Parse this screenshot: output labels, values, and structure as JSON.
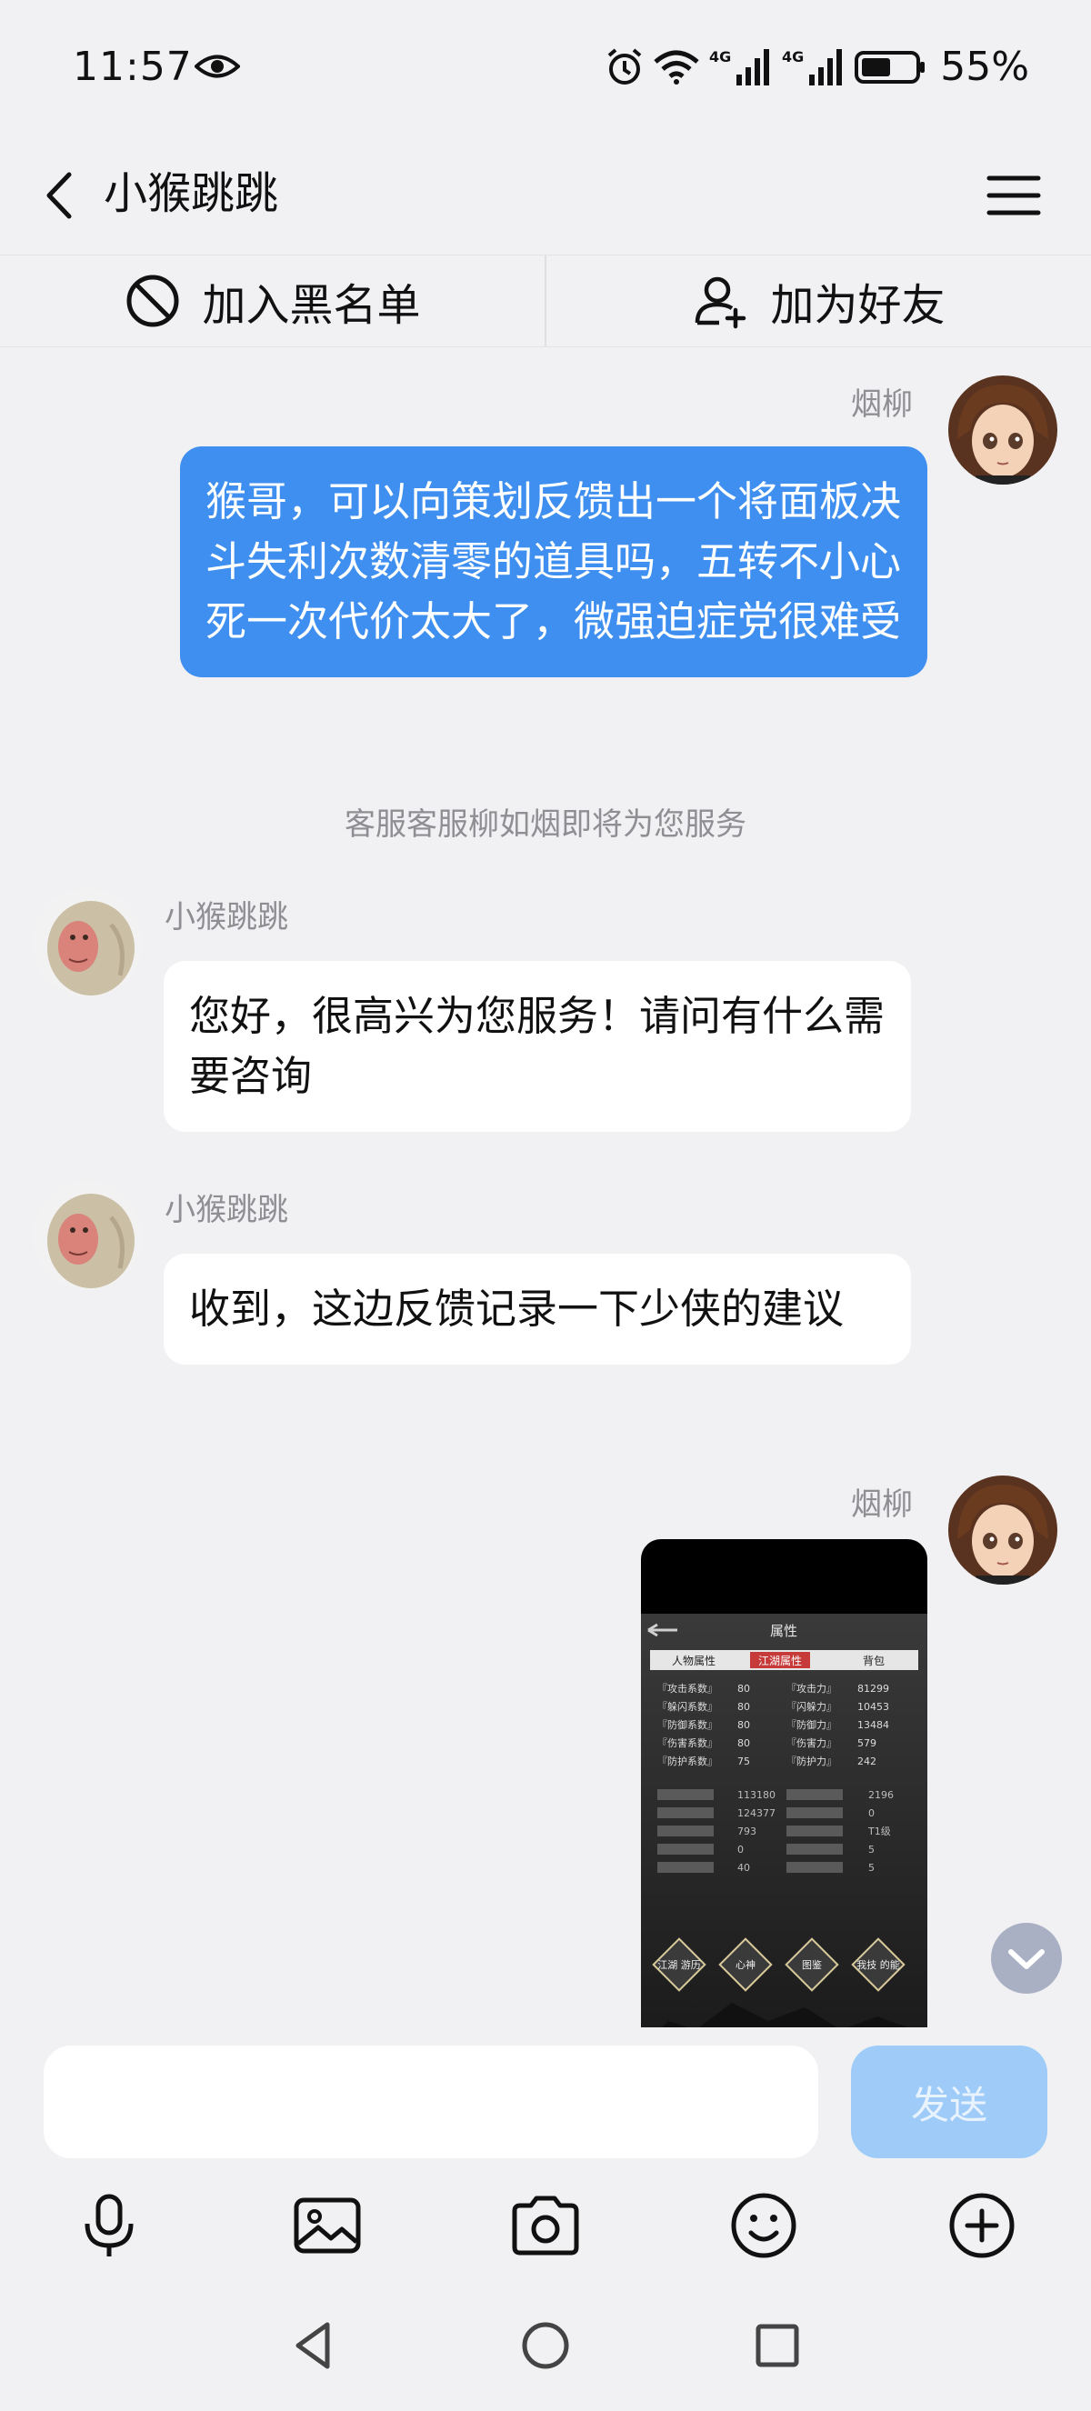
{
  "status_bar": {
    "time": "11:57",
    "network_1": "4G",
    "network_2": "4G",
    "battery": "55%",
    "battery_level": 0.55
  },
  "header": {
    "title": "小猴跳跳",
    "back_icon": "chevron-left-icon",
    "menu_icon": "hamburger-menu-icon"
  },
  "actions": {
    "blacklist_label": "加入黑名单",
    "add_friend_label": "加为好友"
  },
  "messages": [
    {
      "sender": "烟柳",
      "side": "right",
      "text": "猴哥，可以向策划反馈出一个将面板决斗失利次数清零的道具吗，五转不小心死一次代价太大了，微强迫症党很难受"
    },
    {
      "sender": "",
      "side": "system",
      "text": "客服客服柳如烟即将为您服务"
    },
    {
      "sender": "小猴跳跳",
      "side": "left",
      "text": "您好，很高兴为您服务！请问有什么需要咨询"
    },
    {
      "sender": "小猴跳跳",
      "side": "left",
      "text": "收到，这边反馈记录一下少侠的建议"
    },
    {
      "sender": "烟柳",
      "side": "right",
      "type": "image",
      "text": ""
    }
  ],
  "screenshot": {
    "title": "属性",
    "tabs": [
      "人物属性",
      "江湖属性",
      "背包"
    ],
    "stats_left": [
      [
        "『攻击系数』",
        "80"
      ],
      [
        "『躲闪系数』",
        "80"
      ],
      [
        "『防御系数』",
        "80"
      ],
      [
        "『伤害系数』",
        "80"
      ],
      [
        "『防护系数』",
        "75"
      ]
    ],
    "stats_right": [
      [
        "『攻击力』",
        "81299"
      ],
      [
        "『闪躲力』",
        "10453"
      ],
      [
        "『防御力』",
        "13484"
      ],
      [
        "『伤害力』",
        "579"
      ],
      [
        "『防护力』",
        "242"
      ]
    ],
    "stats2_left_values": [
      "113180",
      "124377",
      "793",
      "0",
      "40"
    ],
    "stats2_right_values": [
      "2196",
      "0",
      "T1级",
      "5",
      "5"
    ],
    "buttons": [
      "江湖\n游历",
      "心神",
      "图鉴",
      "我技\n的能"
    ]
  },
  "input": {
    "placeholder": "",
    "send_label": "发送"
  }
}
